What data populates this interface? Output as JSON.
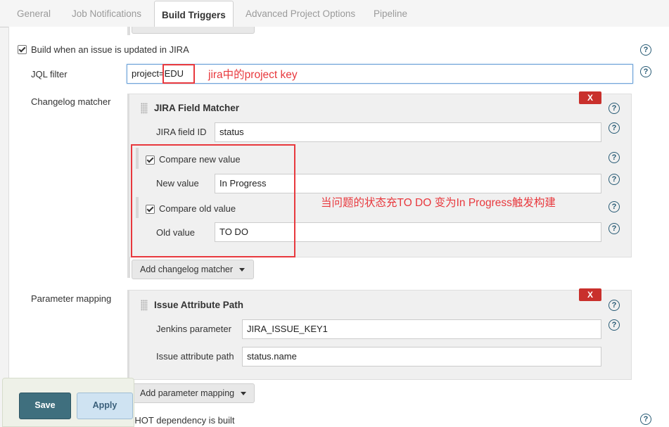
{
  "tabs": [
    {
      "label": "General",
      "active": false
    },
    {
      "label": "Job Notifications",
      "active": false
    },
    {
      "label": "Build Triggers",
      "active": true
    },
    {
      "label": "Advanced Project Options",
      "active": false
    },
    {
      "label": "Pipeline",
      "active": false
    }
  ],
  "trigger": {
    "label": "Build when an issue is updated in JIRA",
    "checked": true
  },
  "jql": {
    "label": "JQL filter",
    "value": "project=EDU"
  },
  "changelog": {
    "label": "Changelog matcher",
    "card_title": "JIRA Field Matcher",
    "close_label": "X",
    "field_id": {
      "label": "JIRA field ID",
      "value": "status"
    },
    "compare_new": {
      "label": "Compare new value",
      "checked": true
    },
    "new_value": {
      "label": "New value",
      "value": "In Progress"
    },
    "compare_old": {
      "label": "Compare old value",
      "checked": true
    },
    "old_value": {
      "label": "Old value",
      "value": "TO DO"
    },
    "add_button": "Add changelog matcher"
  },
  "parameter_mapping": {
    "label": "Parameter mapping",
    "card_title": "Issue Attribute Path",
    "close_label": "X",
    "jenkins_parameter": {
      "label": "Jenkins parameter",
      "value": "JIRA_ISSUE_KEY1"
    },
    "attribute_path": {
      "label": "Issue attribute path",
      "value": "status.name"
    },
    "add_button": "Add parameter mapping"
  },
  "footer_trigger": {
    "label": "Build whenever a SNAPSHOT dependency is built",
    "checked": false
  },
  "buttons": {
    "save": "Save",
    "apply": "Apply"
  },
  "annotations": {
    "project_key_note": "jira中的project key",
    "status_note": "当问题的状态充TO DO 变为In Progress触发构建"
  },
  "icons": {
    "help": "help-question-icon",
    "drag": "drag-handle-icon",
    "caret": "caret-down-icon"
  },
  "colors": {
    "annotation": "#e8383d",
    "save": "#3f6f7e",
    "close": "#c9302c",
    "help": "#285b75"
  }
}
